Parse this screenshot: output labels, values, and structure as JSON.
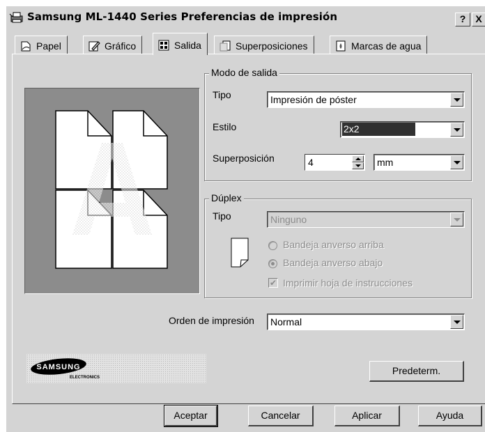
{
  "window": {
    "title": "Samsung ML-1440 Series Preferencias de impresión",
    "help_label": "?",
    "close_label": "X"
  },
  "tabs": [
    {
      "label": "Papel",
      "icon": "paper-icon",
      "active": false
    },
    {
      "label": "Gráfico",
      "icon": "graphic-icon",
      "active": false
    },
    {
      "label": "Salida",
      "icon": "output-icon",
      "active": true
    },
    {
      "label": "Superposiciones",
      "icon": "overlay-icon",
      "active": false
    },
    {
      "label": "Marcas de agua",
      "icon": "watermark-icon",
      "active": false
    }
  ],
  "output_mode": {
    "legend": "Modo de salida",
    "type_label": "Tipo",
    "type_value": "Impresión de póster",
    "style_label": "Estilo",
    "style_value": "2x2",
    "overlap_label": "Superposición",
    "overlap_value": "4",
    "overlap_unit": "mm"
  },
  "duplex": {
    "legend": "Dúplex",
    "type_label": "Tipo",
    "type_value": "Ninguno",
    "option_up": "Bandeja anverso arriba",
    "option_down": "Bandeja anverso abajo",
    "instructions_label": "Imprimir hoja de instrucciones"
  },
  "print_order": {
    "label": "Orden de impresión",
    "value": "Normal"
  },
  "logo": {
    "brand": "SAMSUNG",
    "sub": "ELECTRONICS"
  },
  "buttons": {
    "defaults": "Predeterm.",
    "accept": "Aceptar",
    "cancel": "Cancelar",
    "apply": "Aplicar",
    "help": "Ayuda"
  },
  "colors": {
    "window_bg": "#d4d4d4",
    "preview_bg": "#8c8c8c",
    "selection_bg": "#303030"
  }
}
